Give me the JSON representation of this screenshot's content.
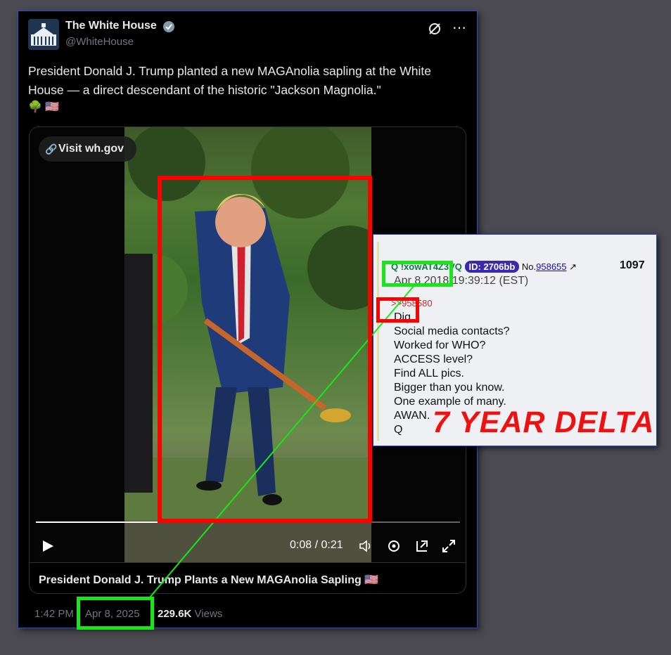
{
  "tweet": {
    "display_name": "The White House",
    "handle": "@WhiteHouse",
    "text": "President Donald J. Trump planted a new MAGAnolia sapling at the White House — a direct descendant of the historic \"Jackson Magnolia.\"",
    "emoji_tree": "🌳",
    "emoji_flag": "🇺🇸",
    "visit_label": "Visit wh.gov",
    "video": {
      "time_label": "0:08 / 0:21",
      "progress": 0.29
    },
    "card_title": "President Donald J. Trump Plants a New MAGAnolia Sapling 🇺🇸",
    "time": "1:42 PM",
    "date": "Apr 8, 2025",
    "views_count": "229.6K",
    "views_label": "Views"
  },
  "qpost": {
    "author": "Q !xowAT4Z3VQ",
    "id_badge": "ID: 2706bb",
    "no_prefix": "No.",
    "post_number": "958655",
    "reply_count": "1097",
    "date": "Apr 8 2018",
    "time": "19:39:12 (EST)",
    "reply_ref": ">>958580",
    "lines": [
      "Dig.",
      "Social media contacts?",
      "Worked for WHO?",
      "ACCESS level?",
      "Find ALL pics.",
      "Bigger than you know.",
      "One example of many.",
      "AWAN.",
      "Q"
    ]
  },
  "overlay": {
    "delta_text": "7 YEAR DELTA"
  },
  "colors": {
    "highlight_green": "#19e619",
    "highlight_red": "#ff0000",
    "twitter_bg": "#000000",
    "text_primary": "#e7e9ea",
    "text_secondary": "#71767b"
  }
}
